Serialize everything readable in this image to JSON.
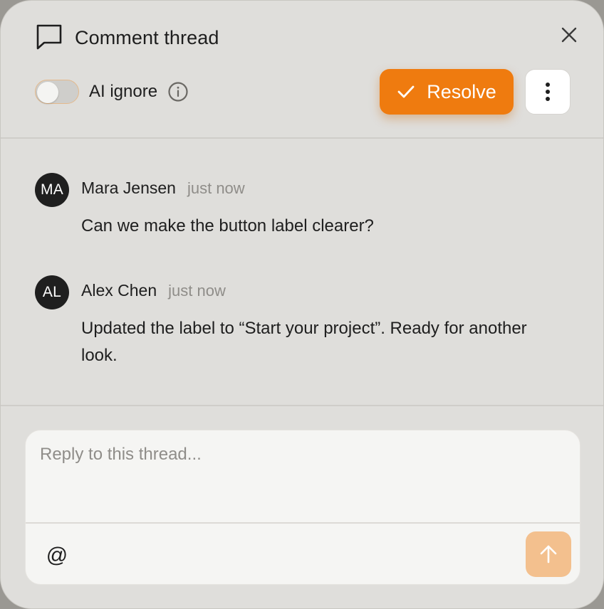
{
  "header": {
    "title": "Comment thread",
    "icons": {
      "thread": "speech-bubble-icon",
      "close": "close-icon"
    }
  },
  "toolbar": {
    "toggle_label": "AI ignore",
    "toggle_on": false,
    "resolve_label": "Resolve",
    "more_icon": "vertical-ellipsis-icon"
  },
  "comments": [
    {
      "initials": "MA",
      "author": "Mara Jensen",
      "time": "just now",
      "text": "Can we make the button label clearer?"
    },
    {
      "initials": "AL",
      "author": "Alex Chen",
      "time": "just now",
      "text": "Updated the label to “Start your project”. Ready for another look."
    }
  ],
  "composer": {
    "placeholder": "Reply to this thread...",
    "value": "",
    "mention_symbol": "@"
  },
  "colors": {
    "accent": "#ef7b0f",
    "send_disabled": "#f3c08e",
    "panel_bg": "#dfdedb",
    "composer_bg": "#f5f5f3"
  }
}
